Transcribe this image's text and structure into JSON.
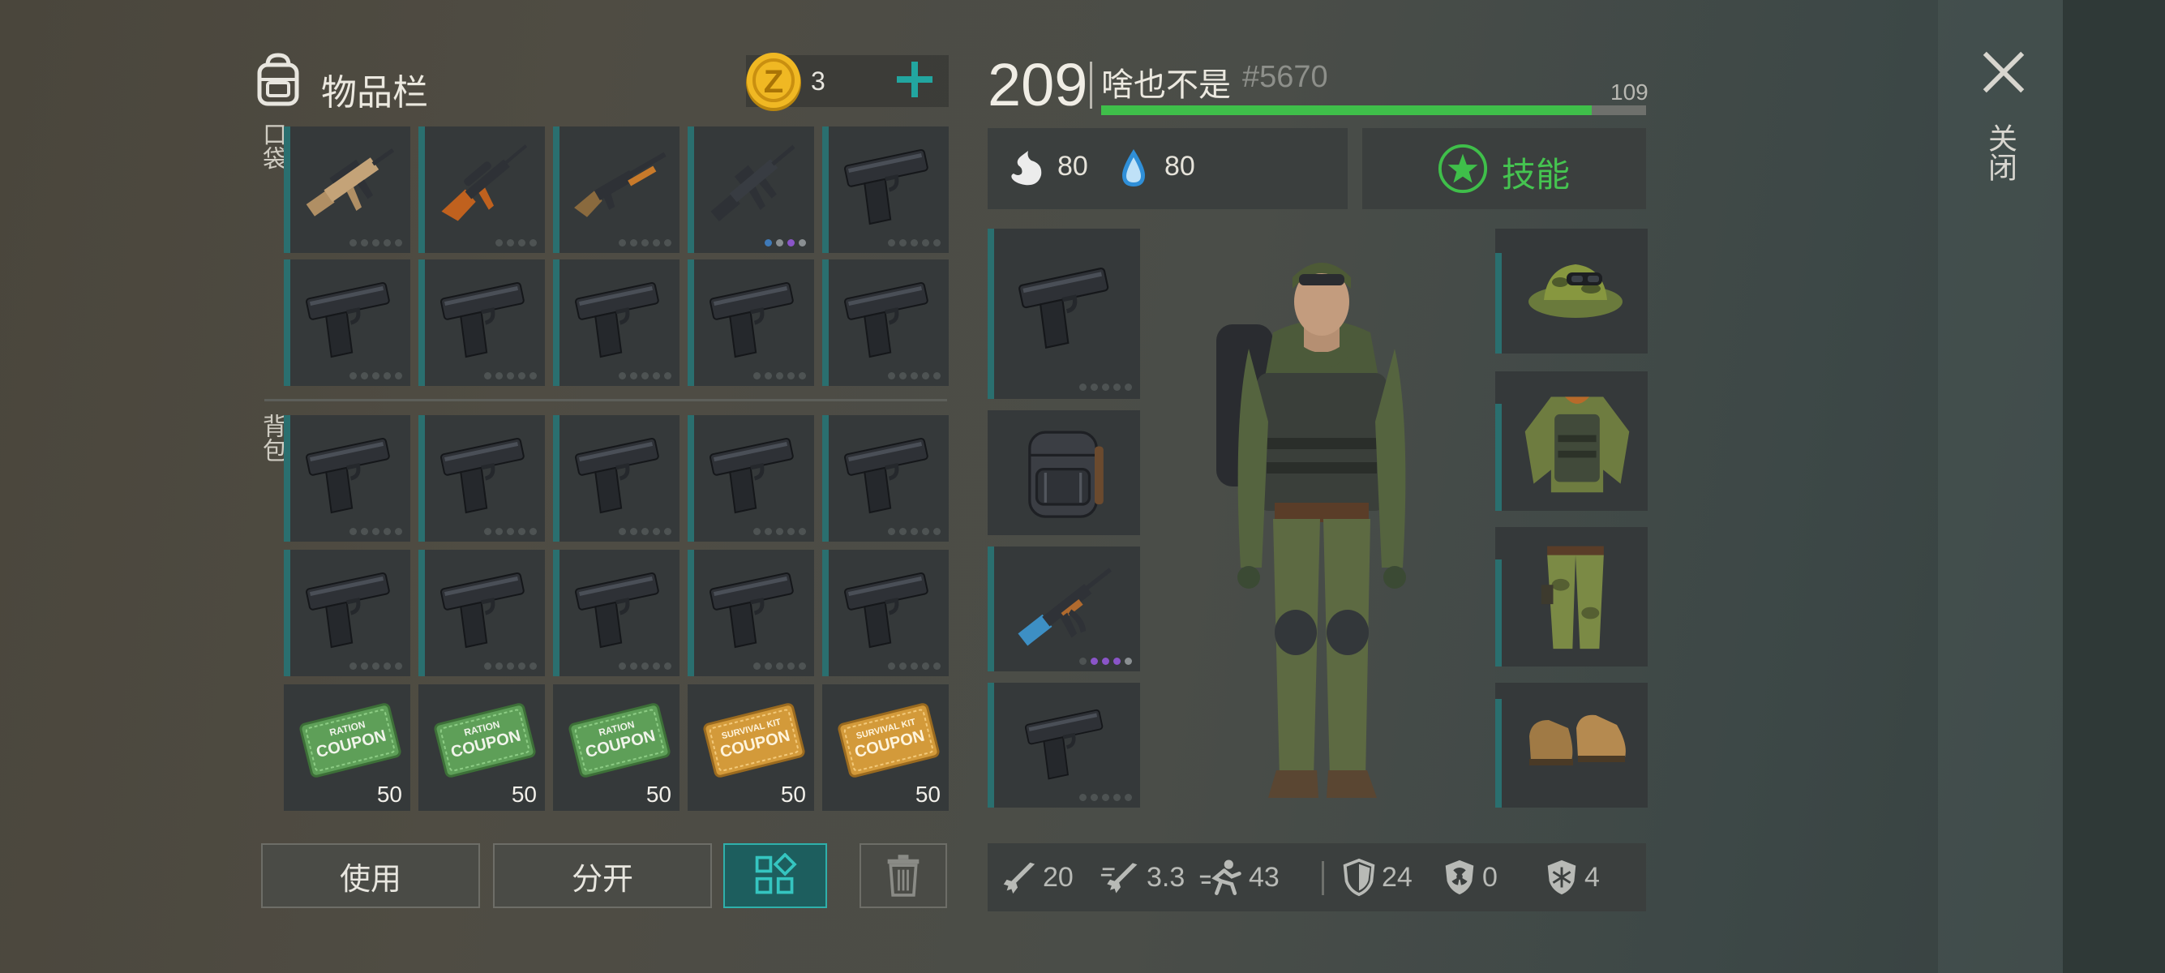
{
  "inventory": {
    "title": "物品栏",
    "coins": "3",
    "pocket_label": "口袋",
    "backpack_label": "背包",
    "slots_pocket": [
      {
        "item": "scar-rifle-icon",
        "dots": 5
      },
      {
        "item": "sniper-rifle-icon",
        "dots": 4
      },
      {
        "item": "shotgun-icon",
        "dots": 5
      },
      {
        "item": "m16-rifle-icon",
        "dots": 4,
        "dot_colors": [
          "#3f7ab8",
          "#8a8f92",
          "#8a55c8",
          "#8a8f92"
        ]
      },
      {
        "item": "pistol-icon",
        "dots": 5
      },
      {
        "item": "pistol-icon",
        "dots": 5
      },
      {
        "item": "pistol-icon",
        "dots": 5
      },
      {
        "item": "pistol-icon",
        "dots": 5
      },
      {
        "item": "pistol-icon",
        "dots": 5
      },
      {
        "item": "pistol-icon",
        "dots": 5
      }
    ],
    "slots_backpack": [
      {
        "item": "pistol-icon",
        "dots": 5
      },
      {
        "item": "pistol-icon",
        "dots": 5
      },
      {
        "item": "pistol-icon",
        "dots": 5
      },
      {
        "item": "pistol-icon",
        "dots": 5
      },
      {
        "item": "pistol-icon",
        "dots": 5
      },
      {
        "item": "pistol-icon",
        "dots": 5
      },
      {
        "item": "pistol-icon",
        "dots": 5
      },
      {
        "item": "pistol-icon",
        "dots": 5
      },
      {
        "item": "pistol-icon",
        "dots": 5
      },
      {
        "item": "pistol-icon",
        "dots": 5
      },
      {
        "item": "ration-coupon-icon",
        "qty": "50",
        "line1": "RATION",
        "line2": "COUPON"
      },
      {
        "item": "ration-coupon-icon",
        "qty": "50",
        "line1": "RATION",
        "line2": "COUPON"
      },
      {
        "item": "ration-coupon-icon",
        "qty": "50",
        "line1": "RATION",
        "line2": "COUPON"
      },
      {
        "item": "survival-kit-coupon-icon",
        "qty": "50",
        "line1": "SURVIVAL KIT",
        "line2": "COUPON"
      },
      {
        "item": "survival-kit-coupon-icon",
        "qty": "50",
        "line1": "SURVIVAL KIT",
        "line2": "COUPON"
      }
    ],
    "buttons": {
      "use": "使用",
      "split": "分开"
    }
  },
  "player": {
    "level": "209",
    "name": "啥也不是",
    "tag": "#5670",
    "xp_label": "109",
    "xp_fraction": 0.9,
    "hunger": "80",
    "thirst": "80",
    "skills_label": "技能"
  },
  "stats": {
    "attack": "20",
    "attack_speed": "3.3",
    "move_speed": "43",
    "armor": "24",
    "radiation": "0",
    "cold": "4"
  },
  "close_label": "关闭",
  "colors": {
    "accent_green": "#3fbf4a",
    "teal": "#2a6f6f",
    "gold": "#e0a81a",
    "plus": "#22a6a0"
  }
}
